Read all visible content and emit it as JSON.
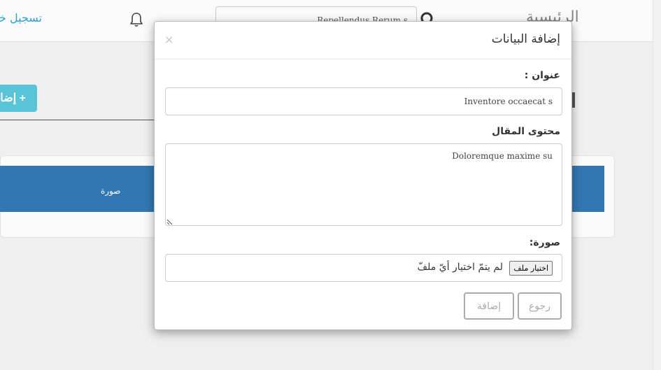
{
  "header": {
    "home_label": "الرئيسية",
    "search_value": "Repellendus Rerum s",
    "register_label": "تسجيل خروج"
  },
  "page": {
    "add_button_label": "+ إضافة",
    "table_columns": [
      "صورة"
    ]
  },
  "modal": {
    "title": "إضافة البيانات",
    "close_symbol": "×",
    "title_label": "عنوان :",
    "title_value": "Inventore occaecat s",
    "content_label": "محتوى المقال",
    "content_value": "Doloremque maxime su",
    "image_label": "صورة:",
    "file_button_label": "اختيار ملف",
    "file_status": "لم يتمّ اختيار أيّ ملفّ",
    "back_label": "رجوع",
    "submit_label": "إضافة"
  },
  "colors": {
    "table_header": "#337ab7",
    "add_button": "#5bc8dc",
    "register_link": "#2ea6d6"
  },
  "icons": [
    "search-icon",
    "bell-icon",
    "close-icon"
  ]
}
